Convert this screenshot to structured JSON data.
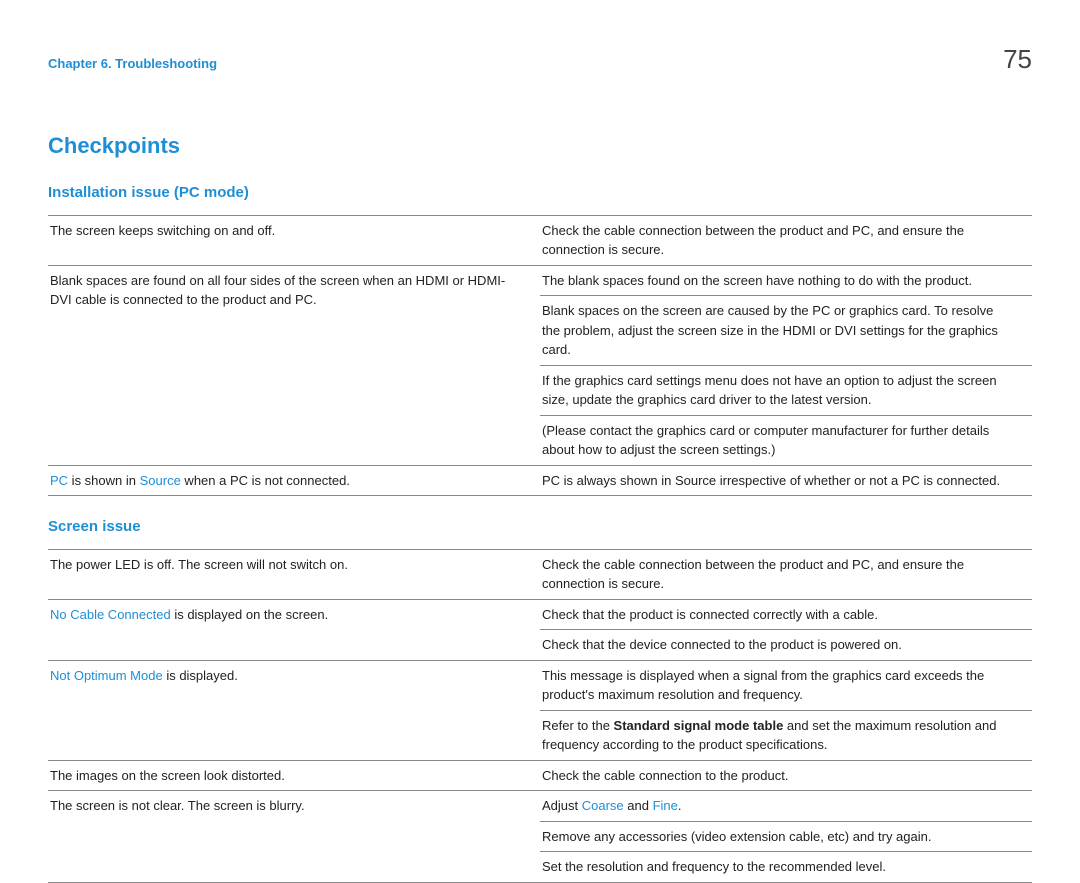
{
  "header": {
    "chapter": "Chapter 6. Troubleshooting",
    "page": "75"
  },
  "main_heading": "Checkpoints",
  "sections": {
    "installation": {
      "heading": "Installation issue (PC mode)",
      "r0c0": "The screen keeps switching on and off.",
      "r0c1": "Check the cable connection between the product and PC, and ensure the connection is secure.",
      "r1c0": "Blank spaces are found on all four sides of the screen when an HDMI or HDMI-DVI cable is connected to the product and PC.",
      "r1c1": "The blank spaces found on the screen have nothing to do with the product.",
      "r2c1": "Blank spaces on the screen are caused by the PC or graphics card. To resolve the problem, adjust the screen size in the HDMI or DVI settings for the graphics card.",
      "r3c1": "If the graphics card settings menu does not have an option to adjust the screen size, update the graphics card driver to the latest version.",
      "r4c1": "(Please contact the graphics card or computer manufacturer for further details about how to adjust the screen settings.)",
      "r5c0_pc": "PC",
      "r5c0_mid": " is shown in ",
      "r5c0_src": "Source",
      "r5c0_end": " when a PC is not connected.",
      "r5c1": "PC is always shown in Source irrespective of whether or not a PC is connected."
    },
    "screen": {
      "heading": "Screen issue",
      "r0c0": "The power LED is off. The screen will not switch on.",
      "r0c1": "Check the cable connection between the product and PC, and ensure the connection is secure.",
      "r1c0_a": "No Cable Connected",
      "r1c0_b": " is displayed on the screen.",
      "r1c1": "Check that the product is connected correctly with a cable.",
      "r2c1": "Check that the device connected to the product is powered on.",
      "r3c0_a": "Not Optimum Mode",
      "r3c0_b": " is displayed.",
      "r3c1": "This message is displayed when a signal from the graphics card exceeds the product's maximum resolution and frequency.",
      "r4c1_a": "Refer to the ",
      "r4c1_b": "Standard signal mode table",
      "r4c1_c": " and set the maximum resolution and frequency according to the product specifications.",
      "r5c0": "The images on the screen look distorted.",
      "r5c1": "Check the cable connection to the product.",
      "r6c0": "The screen is not clear. The screen is blurry.",
      "r6c1_a": "Adjust ",
      "r6c1_b": "Coarse",
      "r6c1_c": " and ",
      "r6c1_d": "Fine",
      "r6c1_e": ".",
      "r7c1": "Remove any accessories (video extension cable, etc) and try again.",
      "r8c1": "Set the resolution and frequency to the recommended level."
    }
  }
}
